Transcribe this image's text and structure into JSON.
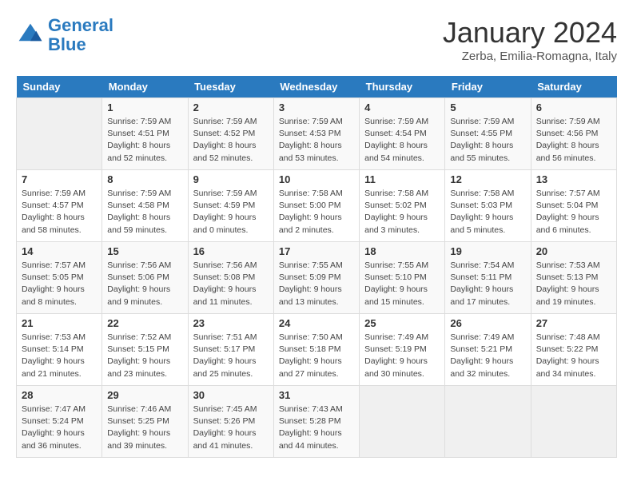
{
  "header": {
    "logo_line1": "General",
    "logo_line2": "Blue",
    "month": "January 2024",
    "location": "Zerba, Emilia-Romagna, Italy"
  },
  "weekdays": [
    "Sunday",
    "Monday",
    "Tuesday",
    "Wednesday",
    "Thursday",
    "Friday",
    "Saturday"
  ],
  "weeks": [
    [
      {
        "day": "",
        "sunrise": "",
        "sunset": "",
        "daylight": ""
      },
      {
        "day": "1",
        "sunrise": "Sunrise: 7:59 AM",
        "sunset": "Sunset: 4:51 PM",
        "daylight": "Daylight: 8 hours and 52 minutes."
      },
      {
        "day": "2",
        "sunrise": "Sunrise: 7:59 AM",
        "sunset": "Sunset: 4:52 PM",
        "daylight": "Daylight: 8 hours and 52 minutes."
      },
      {
        "day": "3",
        "sunrise": "Sunrise: 7:59 AM",
        "sunset": "Sunset: 4:53 PM",
        "daylight": "Daylight: 8 hours and 53 minutes."
      },
      {
        "day": "4",
        "sunrise": "Sunrise: 7:59 AM",
        "sunset": "Sunset: 4:54 PM",
        "daylight": "Daylight: 8 hours and 54 minutes."
      },
      {
        "day": "5",
        "sunrise": "Sunrise: 7:59 AM",
        "sunset": "Sunset: 4:55 PM",
        "daylight": "Daylight: 8 hours and 55 minutes."
      },
      {
        "day": "6",
        "sunrise": "Sunrise: 7:59 AM",
        "sunset": "Sunset: 4:56 PM",
        "daylight": "Daylight: 8 hours and 56 minutes."
      }
    ],
    [
      {
        "day": "7",
        "sunrise": "Sunrise: 7:59 AM",
        "sunset": "Sunset: 4:57 PM",
        "daylight": "Daylight: 8 hours and 58 minutes."
      },
      {
        "day": "8",
        "sunrise": "Sunrise: 7:59 AM",
        "sunset": "Sunset: 4:58 PM",
        "daylight": "Daylight: 8 hours and 59 minutes."
      },
      {
        "day": "9",
        "sunrise": "Sunrise: 7:59 AM",
        "sunset": "Sunset: 4:59 PM",
        "daylight": "Daylight: 9 hours and 0 minutes."
      },
      {
        "day": "10",
        "sunrise": "Sunrise: 7:58 AM",
        "sunset": "Sunset: 5:00 PM",
        "daylight": "Daylight: 9 hours and 2 minutes."
      },
      {
        "day": "11",
        "sunrise": "Sunrise: 7:58 AM",
        "sunset": "Sunset: 5:02 PM",
        "daylight": "Daylight: 9 hours and 3 minutes."
      },
      {
        "day": "12",
        "sunrise": "Sunrise: 7:58 AM",
        "sunset": "Sunset: 5:03 PM",
        "daylight": "Daylight: 9 hours and 5 minutes."
      },
      {
        "day": "13",
        "sunrise": "Sunrise: 7:57 AM",
        "sunset": "Sunset: 5:04 PM",
        "daylight": "Daylight: 9 hours and 6 minutes."
      }
    ],
    [
      {
        "day": "14",
        "sunrise": "Sunrise: 7:57 AM",
        "sunset": "Sunset: 5:05 PM",
        "daylight": "Daylight: 9 hours and 8 minutes."
      },
      {
        "day": "15",
        "sunrise": "Sunrise: 7:56 AM",
        "sunset": "Sunset: 5:06 PM",
        "daylight": "Daylight: 9 hours and 9 minutes."
      },
      {
        "day": "16",
        "sunrise": "Sunrise: 7:56 AM",
        "sunset": "Sunset: 5:08 PM",
        "daylight": "Daylight: 9 hours and 11 minutes."
      },
      {
        "day": "17",
        "sunrise": "Sunrise: 7:55 AM",
        "sunset": "Sunset: 5:09 PM",
        "daylight": "Daylight: 9 hours and 13 minutes."
      },
      {
        "day": "18",
        "sunrise": "Sunrise: 7:55 AM",
        "sunset": "Sunset: 5:10 PM",
        "daylight": "Daylight: 9 hours and 15 minutes."
      },
      {
        "day": "19",
        "sunrise": "Sunrise: 7:54 AM",
        "sunset": "Sunset: 5:11 PM",
        "daylight": "Daylight: 9 hours and 17 minutes."
      },
      {
        "day": "20",
        "sunrise": "Sunrise: 7:53 AM",
        "sunset": "Sunset: 5:13 PM",
        "daylight": "Daylight: 9 hours and 19 minutes."
      }
    ],
    [
      {
        "day": "21",
        "sunrise": "Sunrise: 7:53 AM",
        "sunset": "Sunset: 5:14 PM",
        "daylight": "Daylight: 9 hours and 21 minutes."
      },
      {
        "day": "22",
        "sunrise": "Sunrise: 7:52 AM",
        "sunset": "Sunset: 5:15 PM",
        "daylight": "Daylight: 9 hours and 23 minutes."
      },
      {
        "day": "23",
        "sunrise": "Sunrise: 7:51 AM",
        "sunset": "Sunset: 5:17 PM",
        "daylight": "Daylight: 9 hours and 25 minutes."
      },
      {
        "day": "24",
        "sunrise": "Sunrise: 7:50 AM",
        "sunset": "Sunset: 5:18 PM",
        "daylight": "Daylight: 9 hours and 27 minutes."
      },
      {
        "day": "25",
        "sunrise": "Sunrise: 7:49 AM",
        "sunset": "Sunset: 5:19 PM",
        "daylight": "Daylight: 9 hours and 30 minutes."
      },
      {
        "day": "26",
        "sunrise": "Sunrise: 7:49 AM",
        "sunset": "Sunset: 5:21 PM",
        "daylight": "Daylight: 9 hours and 32 minutes."
      },
      {
        "day": "27",
        "sunrise": "Sunrise: 7:48 AM",
        "sunset": "Sunset: 5:22 PM",
        "daylight": "Daylight: 9 hours and 34 minutes."
      }
    ],
    [
      {
        "day": "28",
        "sunrise": "Sunrise: 7:47 AM",
        "sunset": "Sunset: 5:24 PM",
        "daylight": "Daylight: 9 hours and 36 minutes."
      },
      {
        "day": "29",
        "sunrise": "Sunrise: 7:46 AM",
        "sunset": "Sunset: 5:25 PM",
        "daylight": "Daylight: 9 hours and 39 minutes."
      },
      {
        "day": "30",
        "sunrise": "Sunrise: 7:45 AM",
        "sunset": "Sunset: 5:26 PM",
        "daylight": "Daylight: 9 hours and 41 minutes."
      },
      {
        "day": "31",
        "sunrise": "Sunrise: 7:43 AM",
        "sunset": "Sunset: 5:28 PM",
        "daylight": "Daylight: 9 hours and 44 minutes."
      },
      {
        "day": "",
        "sunrise": "",
        "sunset": "",
        "daylight": ""
      },
      {
        "day": "",
        "sunrise": "",
        "sunset": "",
        "daylight": ""
      },
      {
        "day": "",
        "sunrise": "",
        "sunset": "",
        "daylight": ""
      }
    ]
  ]
}
